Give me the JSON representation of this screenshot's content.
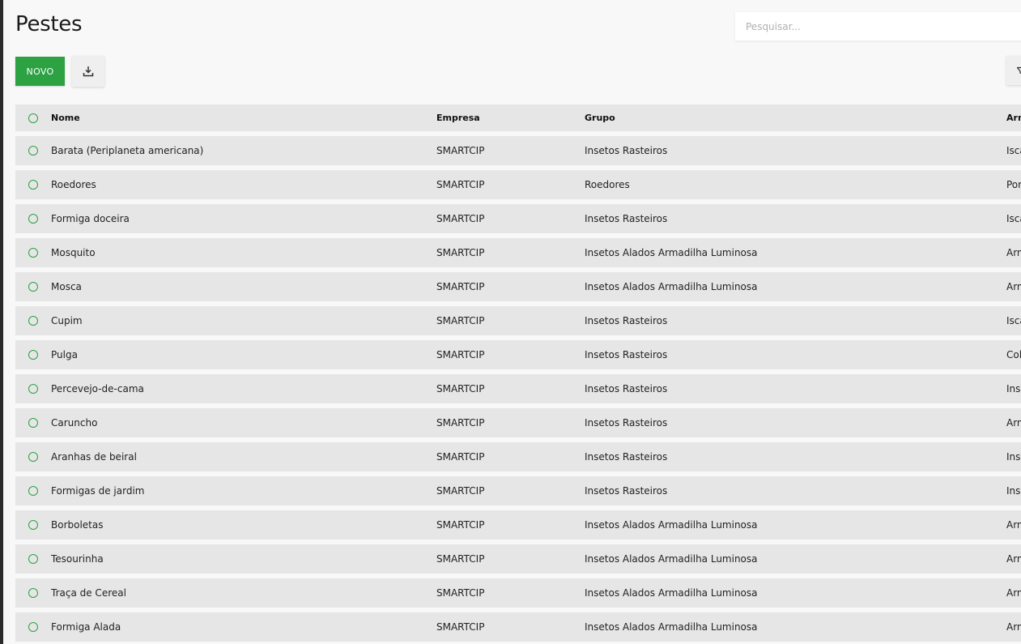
{
  "page": {
    "title": "Pestes"
  },
  "search": {
    "placeholder": "Pesquisar..."
  },
  "toolbar": {
    "new_label": "NOVO",
    "export_icon": "download-icon",
    "filter_icon": "filter-icon"
  },
  "colors": {
    "accent": "#2ca243",
    "row_bg": "#e6e6e6",
    "page_bg": "#f8f8f8"
  },
  "table": {
    "columns": [
      "Nome",
      "Empresa",
      "Grupo",
      "Arm"
    ],
    "rows": [
      [
        "Barata (Periplaneta americana)",
        "SMARTCIP",
        "Insetos Rasteiros",
        "Isca"
      ],
      [
        "Roedores",
        "SMARTCIP",
        "Roedores",
        "Por"
      ],
      [
        "Formiga doceira",
        "SMARTCIP",
        "Insetos Rasteiros",
        "Isca"
      ],
      [
        "Mosquito",
        "SMARTCIP",
        "Insetos Alados Armadilha Luminosa",
        "Arm"
      ],
      [
        "Mosca",
        "SMARTCIP",
        "Insetos Alados Armadilha Luminosa",
        "Arm"
      ],
      [
        "Cupim",
        "SMARTCIP",
        "Insetos Rasteiros",
        "Isca"
      ],
      [
        "Pulga",
        "SMARTCIP",
        "Insetos Rasteiros",
        "Col"
      ],
      [
        "Percevejo-de-cama",
        "SMARTCIP",
        "Insetos Rasteiros",
        "Ins"
      ],
      [
        "Caruncho",
        "SMARTCIP",
        "Insetos Rasteiros",
        "Arm"
      ],
      [
        "Aranhas de beiral",
        "SMARTCIP",
        "Insetos Rasteiros",
        "Ins"
      ],
      [
        "Formigas de jardim",
        "SMARTCIP",
        "Insetos Rasteiros",
        "Ins"
      ],
      [
        "Borboletas",
        "SMARTCIP",
        "Insetos Alados Armadilha Luminosa",
        "Arm"
      ],
      [
        "Tesourinha",
        "SMARTCIP",
        "Insetos Alados Armadilha Luminosa",
        "Arm"
      ],
      [
        "Traça de Cereal",
        "SMARTCIP",
        "Insetos Alados Armadilha Luminosa",
        "Arm"
      ],
      [
        "Formiga Alada",
        "SMARTCIP",
        "Insetos Alados Armadilha Luminosa",
        "Arm"
      ]
    ]
  }
}
